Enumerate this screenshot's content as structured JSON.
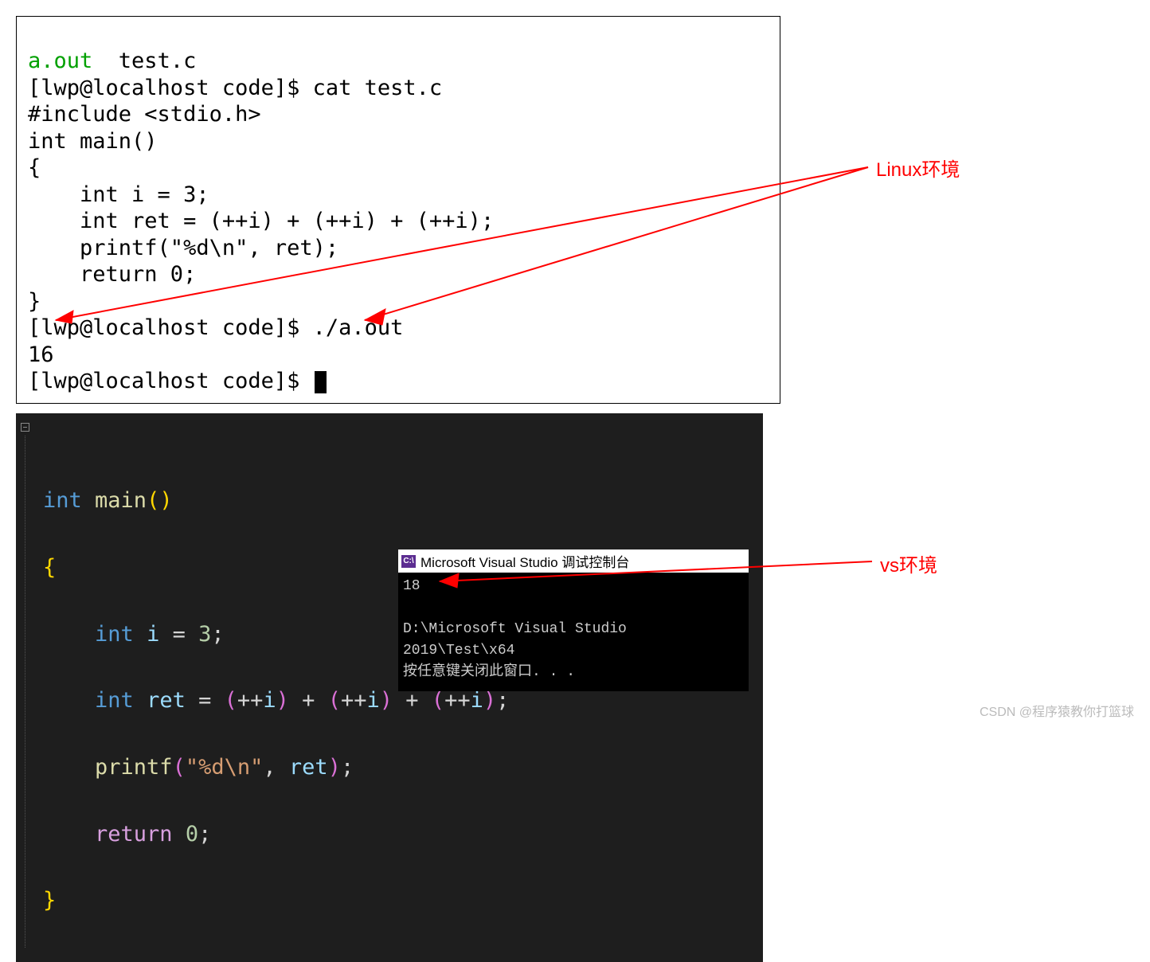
{
  "linux": {
    "ls": {
      "aout": "a.out",
      "testc": "test.c"
    },
    "prompt1": "[lwp@localhost code]$ cat test.c",
    "src_include": "#include <stdio.h>",
    "src_main": "int main()",
    "src_open": "{",
    "src_i": "    int i = 3;",
    "src_ret": "    int ret = (++i) + (++i) + (++i);",
    "src_printf": "    printf(\"%d\\n\", ret);",
    "src_return": "    return 0;",
    "src_close": "}",
    "prompt2": "[lwp@localhost code]$ ./a.out",
    "output": "16",
    "prompt3": "[lwp@localhost code]$ "
  },
  "ide": {
    "sig_int": "int",
    "sig_main": " main",
    "sig_par": "()",
    "brace_open": "{",
    "decl_int": "int",
    "decl_i": " i ",
    "eq": "= ",
    "three": "3",
    "semi": ";",
    "decl_ret": " ret ",
    "plus": " + ",
    "inc": "++",
    "ivar": "i",
    "printf": "printf",
    "str": "\"%d\\n\"",
    "comma": ", ",
    "retvar": "ret",
    "ret_kw": "return",
    "space": " ",
    "zero": "0",
    "brace_close": "}"
  },
  "vsconsole": {
    "title": "Microsoft Visual Studio 调试控制台",
    "out": "18",
    "path": "D:\\Microsoft Visual Studio 2019\\Test\\x64",
    "press": "按任意键关闭此窗口. . ."
  },
  "annotations": {
    "linux": "Linux环境",
    "vs": "vs环境"
  },
  "watermark": "CSDN @程序猿教你打篮球"
}
